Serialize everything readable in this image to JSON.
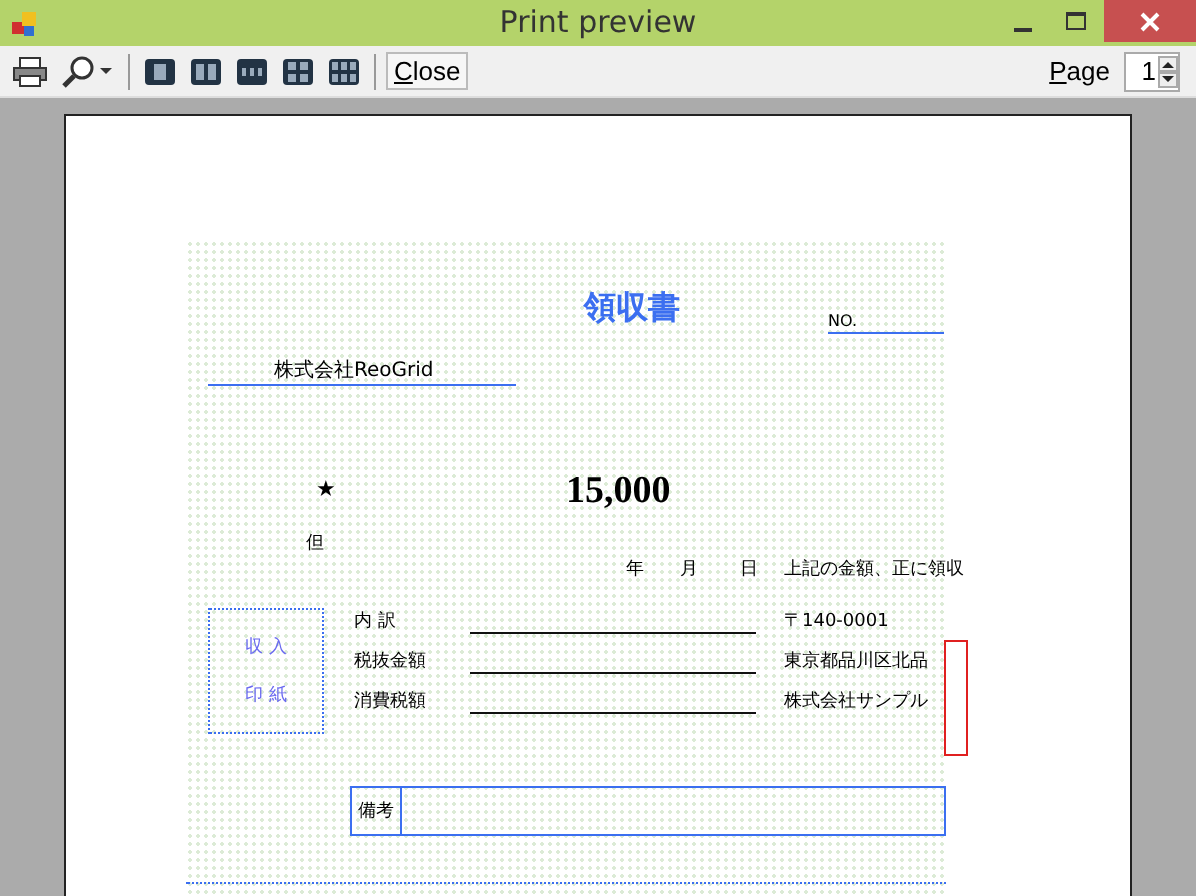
{
  "window": {
    "title": "Print preview"
  },
  "toolbar": {
    "close_button": "Close",
    "page_label": "Page",
    "page_value": "1"
  },
  "receipt": {
    "title": "領収書",
    "number_label": "NO.",
    "addressee": "株式会社ReoGrid",
    "mark": "★",
    "amount": "15,000",
    "purpose_label": "但",
    "date_labels": [
      "年",
      "月",
      "日"
    ],
    "received_text": "上記の金額、正に領収",
    "stamp_box": [
      "収 入",
      "印 紙"
    ],
    "breakdown": [
      "内 訳",
      "税抜金額",
      "消費税額"
    ],
    "issuer": [
      "〒140-0001",
      "東京都品川区北品",
      "株式会社サンプル"
    ],
    "remarks_label": "備考"
  }
}
